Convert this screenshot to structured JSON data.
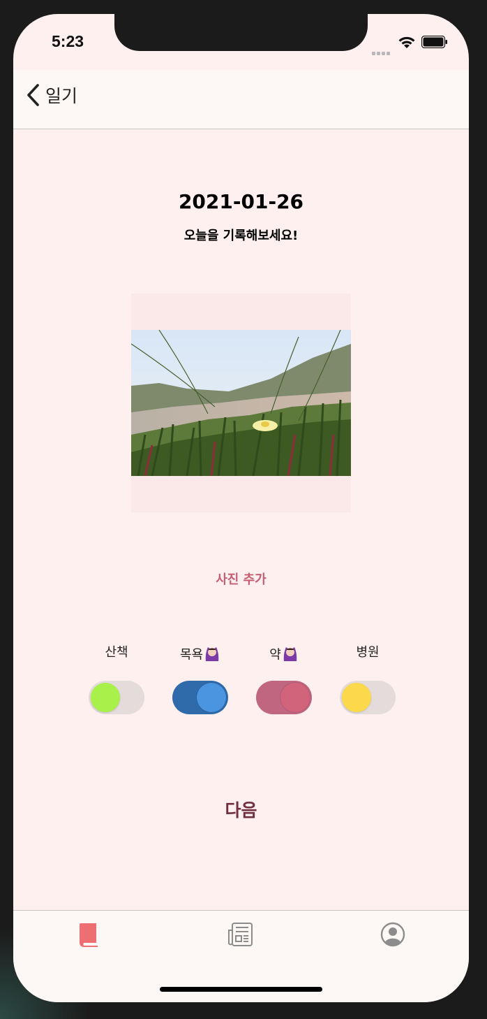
{
  "status_bar": {
    "time": "5:23"
  },
  "nav": {
    "back_label": "일기"
  },
  "main": {
    "date": "2021-01-26",
    "subtitle": "오늘을 기록해보세요!",
    "add_photo_label": "사진 추가",
    "next_label": "다음"
  },
  "toggles": [
    {
      "label": "산책",
      "emoji": false,
      "on": false,
      "track_color": "#e3dcda",
      "knob_color": "#a8f04a"
    },
    {
      "label": "목욕",
      "emoji": true,
      "on": true,
      "track_color": "#2f6aab",
      "knob_color": "#4b94df"
    },
    {
      "label": "약",
      "emoji": true,
      "on": true,
      "track_color": "#c06680",
      "knob_color": "#d1647a"
    },
    {
      "label": "병원",
      "emoji": false,
      "on": false,
      "track_color": "#e3dcda",
      "knob_color": "#fbd94b"
    }
  ],
  "tabs": [
    {
      "name": "diary",
      "icon": "book-icon",
      "active": true,
      "color": "#ee6f72"
    },
    {
      "name": "news",
      "icon": "newspaper-icon",
      "active": false,
      "color": "#8c8c8c"
    },
    {
      "name": "profile",
      "icon": "user-circle-icon",
      "active": false,
      "color": "#8c8c8c"
    }
  ],
  "colors": {
    "background": "#fdf0ee",
    "accent": "#c45e73",
    "next": "#6f2f3e"
  }
}
